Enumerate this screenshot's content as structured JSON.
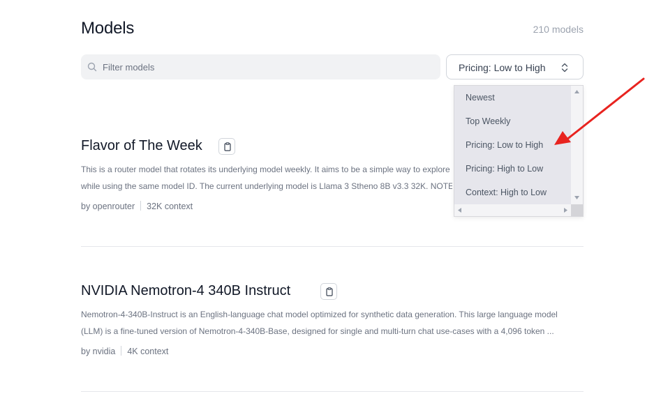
{
  "header": {
    "title": "Models",
    "count": "210 models"
  },
  "search": {
    "placeholder": "Filter models",
    "value": ""
  },
  "sort": {
    "selected": "Pricing: Low to High",
    "options": [
      "Newest",
      "Top Weekly",
      "Pricing: Low to High",
      "Pricing: High to Low",
      "Context: High to Low"
    ]
  },
  "models": [
    {
      "name": "Flavor of The Week",
      "description_line1": "This is a router model that rotates its underlying model weekly. It aims to be a simple way to explore",
      "description_line2": "while using the same model ID.  The current underlying model is Llama 3 Stheno 8B v3.3 32K.  NOTE",
      "author": "by openrouter",
      "context": "32K context"
    },
    {
      "name": "NVIDIA Nemotron-4 340B Instruct",
      "description_line1": "Nemotron-4-340B-Instruct is an English-language chat model optimized for synthetic data generation. This large language model",
      "description_line2": "(LLM) is a fine-tuned version of Nemotron-4-340B-Base, designed for single and multi-turn chat use-cases with a 4,096 token ...",
      "author": "by nvidia",
      "context": "4K context"
    }
  ],
  "colors": {
    "annotation_arrow": "#e8231f",
    "dropdown_bg": "#e6e6ec"
  },
  "icons": [
    "search-icon",
    "chevron-updown-icon",
    "clipboard-icon",
    "scroll-up-icon",
    "scroll-down-icon",
    "scroll-left-icon",
    "scroll-right-icon"
  ]
}
